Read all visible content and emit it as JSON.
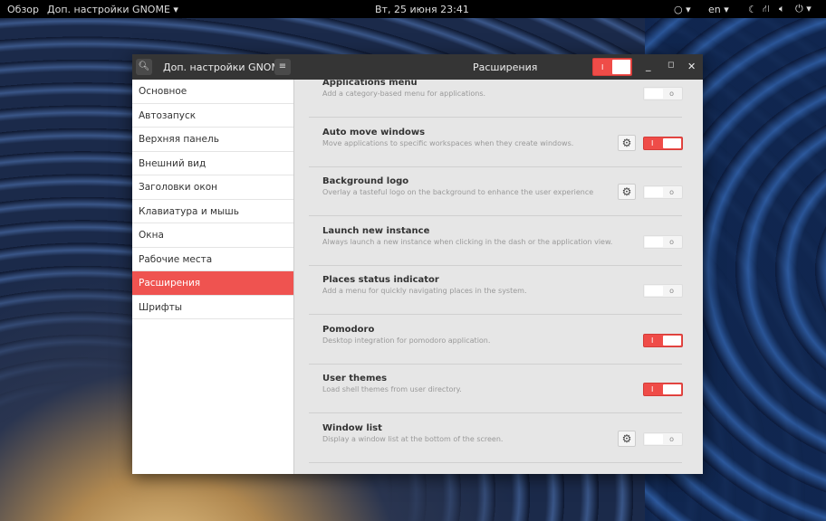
{
  "topbar": {
    "overview": "Обзор",
    "app_menu": "Доп. настройки GNOME ▾",
    "datetime": "Вт, 25 июня  23:41",
    "lang": "en ▾"
  },
  "window": {
    "app_title": "Доп. настройки GNOME",
    "page_title": "Расширения",
    "extensions_enabled": true
  },
  "sidebar": {
    "items": [
      {
        "label": "Основное"
      },
      {
        "label": "Автозапуск"
      },
      {
        "label": "Верхняя панель"
      },
      {
        "label": "Внешний вид"
      },
      {
        "label": "Заголовки окон"
      },
      {
        "label": "Клавиатура и мышь"
      },
      {
        "label": "Окна"
      },
      {
        "label": "Рабочие места"
      },
      {
        "label": "Расширения",
        "selected": true
      },
      {
        "label": "Шрифты"
      }
    ]
  },
  "extensions": [
    {
      "title": "Applications menu",
      "desc": "Add a category-based menu for applications.",
      "enabled": false,
      "settings": false
    },
    {
      "title": "Auto move windows",
      "desc": "Move applications to specific workspaces when they create windows.",
      "enabled": true,
      "settings": true
    },
    {
      "title": "Background logo",
      "desc": "Overlay a tasteful logo on the background to enhance the user experience",
      "enabled": false,
      "settings": true
    },
    {
      "title": "Launch new instance",
      "desc": "Always launch a new instance when clicking in the dash or the application view.",
      "enabled": false,
      "settings": false
    },
    {
      "title": "Places status indicator",
      "desc": "Add a menu for quickly navigating places in the system.",
      "enabled": false,
      "settings": false
    },
    {
      "title": "Pomodoro",
      "desc": "Desktop integration for pomodoro application.",
      "enabled": true,
      "settings": false
    },
    {
      "title": "User themes",
      "desc": "Load shell themes from user directory.",
      "enabled": true,
      "settings": false
    },
    {
      "title": "Window list",
      "desc": "Display a window list at the bottom of the screen.",
      "enabled": false,
      "settings": true
    }
  ],
  "colors": {
    "accent": "#ef5350",
    "header": "#353535"
  }
}
